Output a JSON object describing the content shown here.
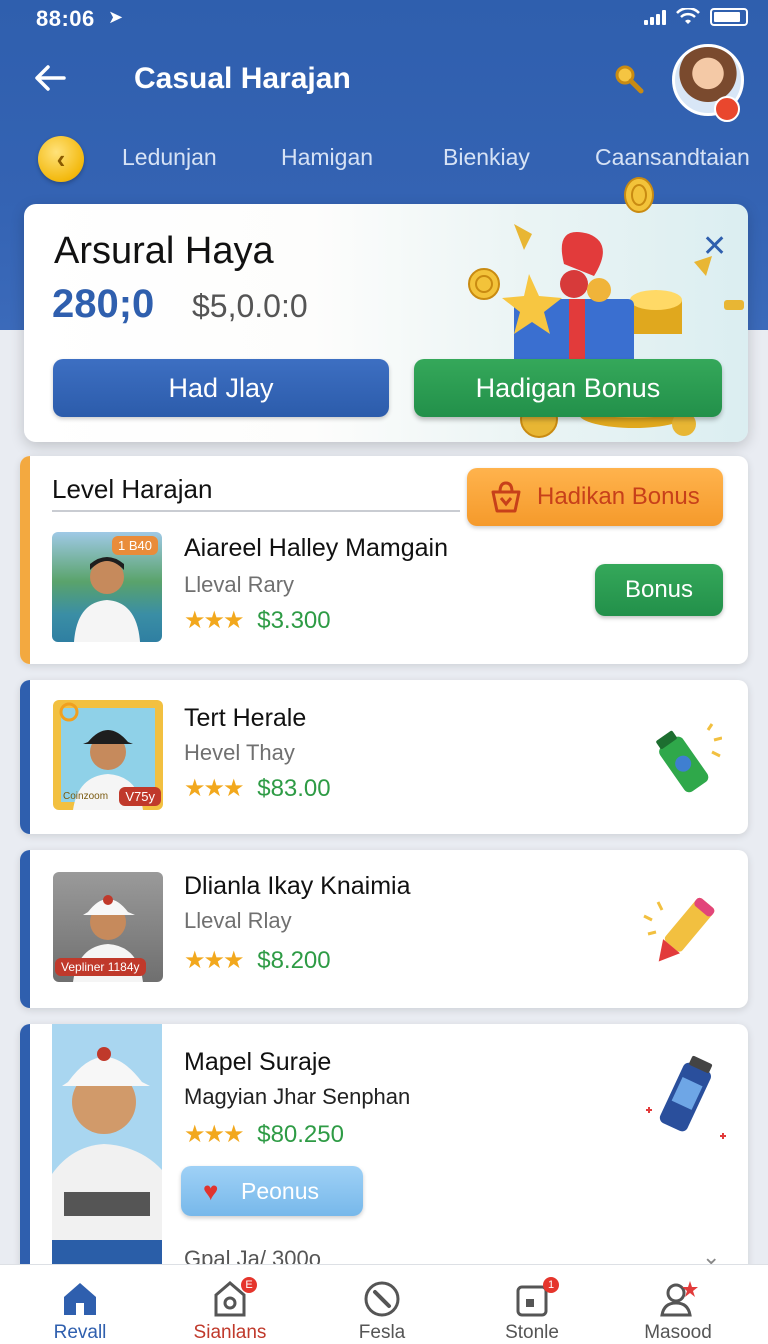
{
  "status_bar": {
    "time": "88:06",
    "location_glyph": "➤"
  },
  "header": {
    "title": "Casual Harajan",
    "back_glyph": "←"
  },
  "tabs": [
    {
      "label": "Ledunjan"
    },
    {
      "label": "Hamigan"
    },
    {
      "label": "Bienkiay"
    },
    {
      "label": "Caansandtaian"
    }
  ],
  "hero": {
    "title": "Arsural Haya",
    "amount": "280;0",
    "sub_amount": "$5,0.0:0",
    "close_glyph": "✕",
    "primary_button": "Had Jlay",
    "bonus_button": "Hadigan Bonus"
  },
  "level_card": {
    "title": "Level Harajan",
    "bonus_button": "Hadikan Bonus"
  },
  "items": [
    {
      "name": "Aiareel Halley Mamgain",
      "level": "Lleval Rary",
      "stars": "★★★",
      "price": "$3.300",
      "thumb_tag": "1 B40",
      "button": "Bonus"
    },
    {
      "name": "Tert Herale",
      "level": "Hevel Thay",
      "stars": "★★★",
      "price": "$83.00",
      "thumb_tag": "V75y",
      "thumb_caption": "Coinzoom"
    },
    {
      "name": "Dlianla Ikay Knaimia",
      "level": "Lleval Rlay",
      "stars": "★★★",
      "price": "$8.200",
      "thumb_tag": "Vepliner 1184y"
    },
    {
      "name": "Mapel Surаje",
      "level": "Magyian Jhar Senphan",
      "stars": "★★★",
      "price": "$80.250",
      "button": "Peonus",
      "partial": "Gpal   Ja/  300o"
    }
  ],
  "bottom_nav": [
    {
      "label": "Revall",
      "icon": "home-icon",
      "active": true
    },
    {
      "label": "Sianlans",
      "icon": "store-icon",
      "badge": "E"
    },
    {
      "label": "Fesla",
      "icon": "compass-icon"
    },
    {
      "label": "Stonle",
      "icon": "clipboard-icon",
      "badge": "1"
    },
    {
      "label": "Masood",
      "icon": "profile-icon"
    }
  ],
  "colors": {
    "primary": "#2f5fae",
    "green": "#2e9b45",
    "orange": "#f59a2b",
    "star": "#f2a81d"
  }
}
